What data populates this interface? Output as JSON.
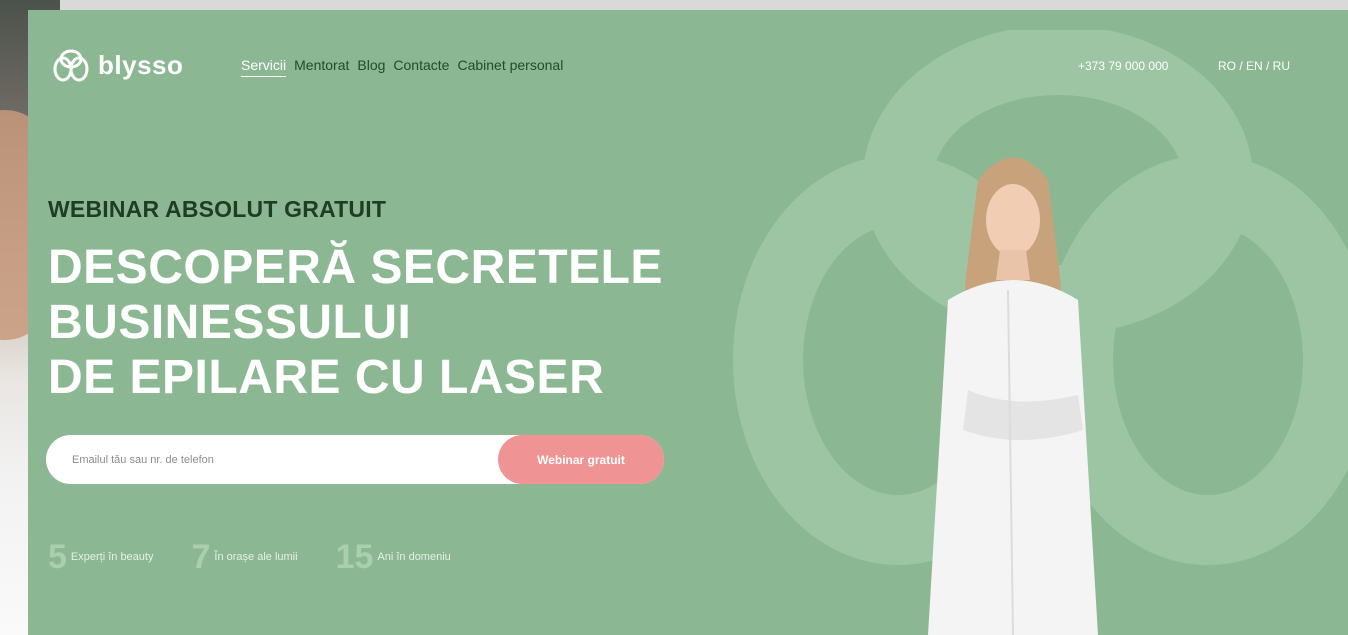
{
  "nav": {
    "logo_text": "blysso",
    "menu": [
      "Servicii",
      "Mentorat",
      "Blog",
      "Contacte",
      "Cabinet personal"
    ],
    "phone": "+373 79 000 000",
    "languages": "RO / EN / RU"
  },
  "hero": {
    "eyebrow": "WEBINAR ABSOLUT GRATUIT",
    "headline": [
      "DESCOPERĂ SECRETELE",
      "BUSINESSULUI",
      "DE EPILARE CU LASER"
    ],
    "input_placeholder": "Emailul tău sau nr. de telefon",
    "cta_label": "Webinar gratuit"
  },
  "stats": [
    {
      "number": "5",
      "text": "Experți în beauty"
    },
    {
      "number": "7",
      "text": "În orașe ale lumii"
    },
    {
      "number": "15",
      "text": "Ani în domeniu"
    }
  ],
  "colors": {
    "background": "#8bb892",
    "accent": "#ef9395",
    "dark_text": "#1f3d25"
  }
}
